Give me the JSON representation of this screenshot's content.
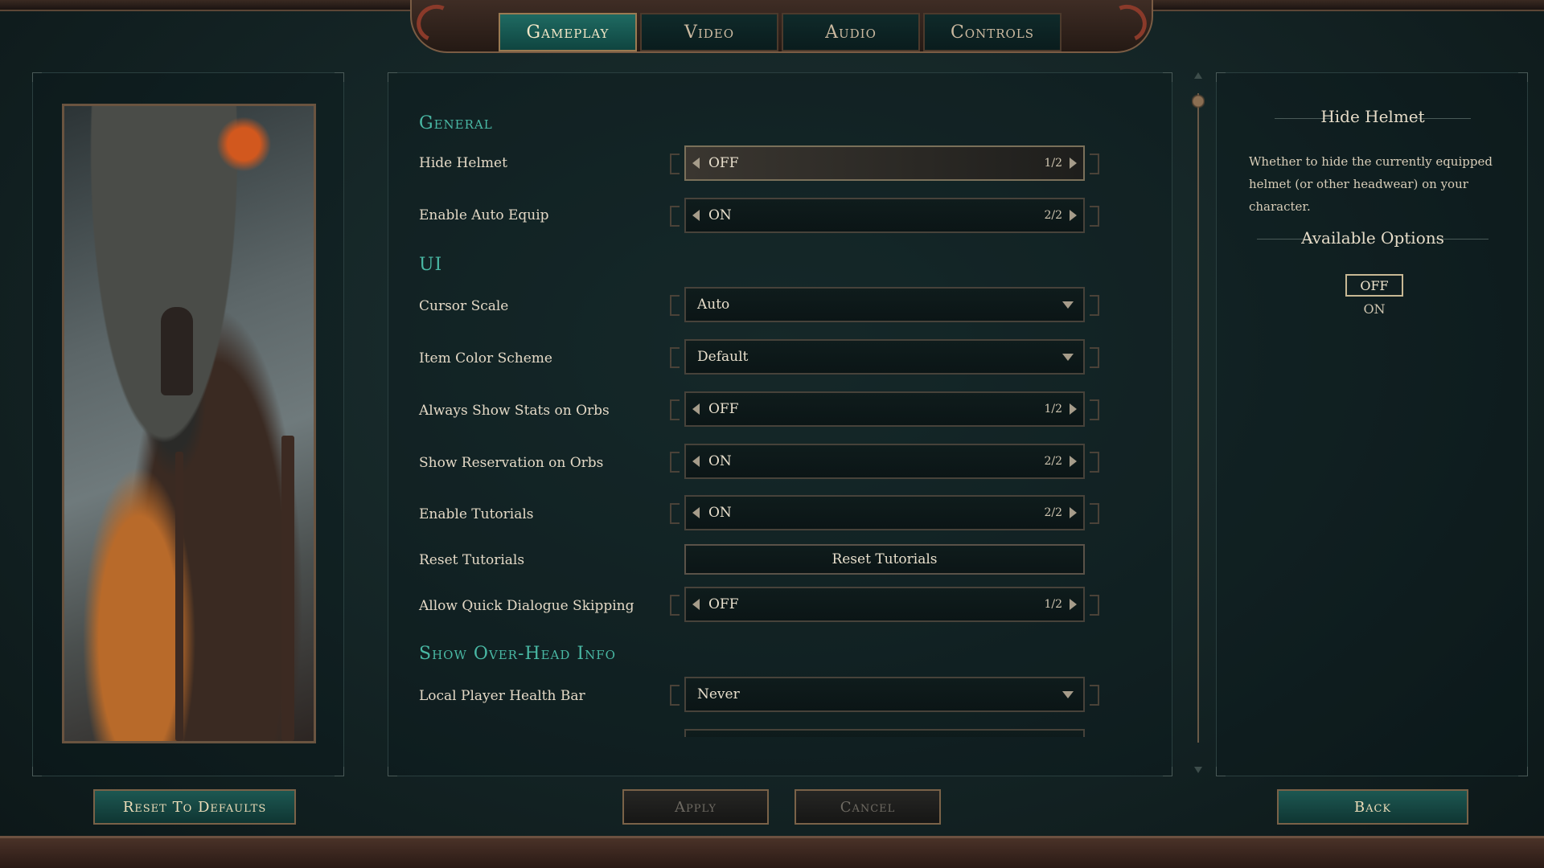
{
  "tabs": [
    {
      "label": "Gameplay"
    },
    {
      "label": "Video"
    },
    {
      "label": "Audio"
    },
    {
      "label": "Controls"
    }
  ],
  "sections": {
    "general": "General",
    "ui": "UI",
    "overhead": "Show Over-Head Info"
  },
  "settings": {
    "hide_helmet": {
      "label": "Hide Helmet",
      "value": "OFF",
      "count": "1/2"
    },
    "auto_equip": {
      "label": "Enable Auto Equip",
      "value": "ON",
      "count": "2/2"
    },
    "cursor_scale": {
      "label": "Cursor Scale",
      "value": "Auto"
    },
    "item_color": {
      "label": "Item Color Scheme",
      "value": "Default"
    },
    "stats_orbs": {
      "label": "Always Show Stats on Orbs",
      "value": "OFF",
      "count": "1/2"
    },
    "reservation_orbs": {
      "label": "Show Reservation on Orbs",
      "value": "ON",
      "count": "2/2"
    },
    "tutorials": {
      "label": "Enable Tutorials",
      "value": "ON",
      "count": "2/2"
    },
    "reset_tutorials": {
      "label": "Reset Tutorials",
      "button": "Reset Tutorials"
    },
    "quick_dialogue": {
      "label": "Allow Quick Dialogue Skipping",
      "value": "OFF",
      "count": "1/2"
    },
    "local_health": {
      "label": "Local Player Health Bar",
      "value": "Never"
    }
  },
  "info": {
    "title": "Hide Helmet",
    "description": "Whether to hide the currently equipped helmet (or other headwear) on your character.",
    "options_title": "Available Options",
    "options": [
      "OFF",
      "ON"
    ]
  },
  "footer": {
    "reset": "Reset To Defaults",
    "apply": "Apply",
    "cancel": "Cancel",
    "back": "Back"
  }
}
